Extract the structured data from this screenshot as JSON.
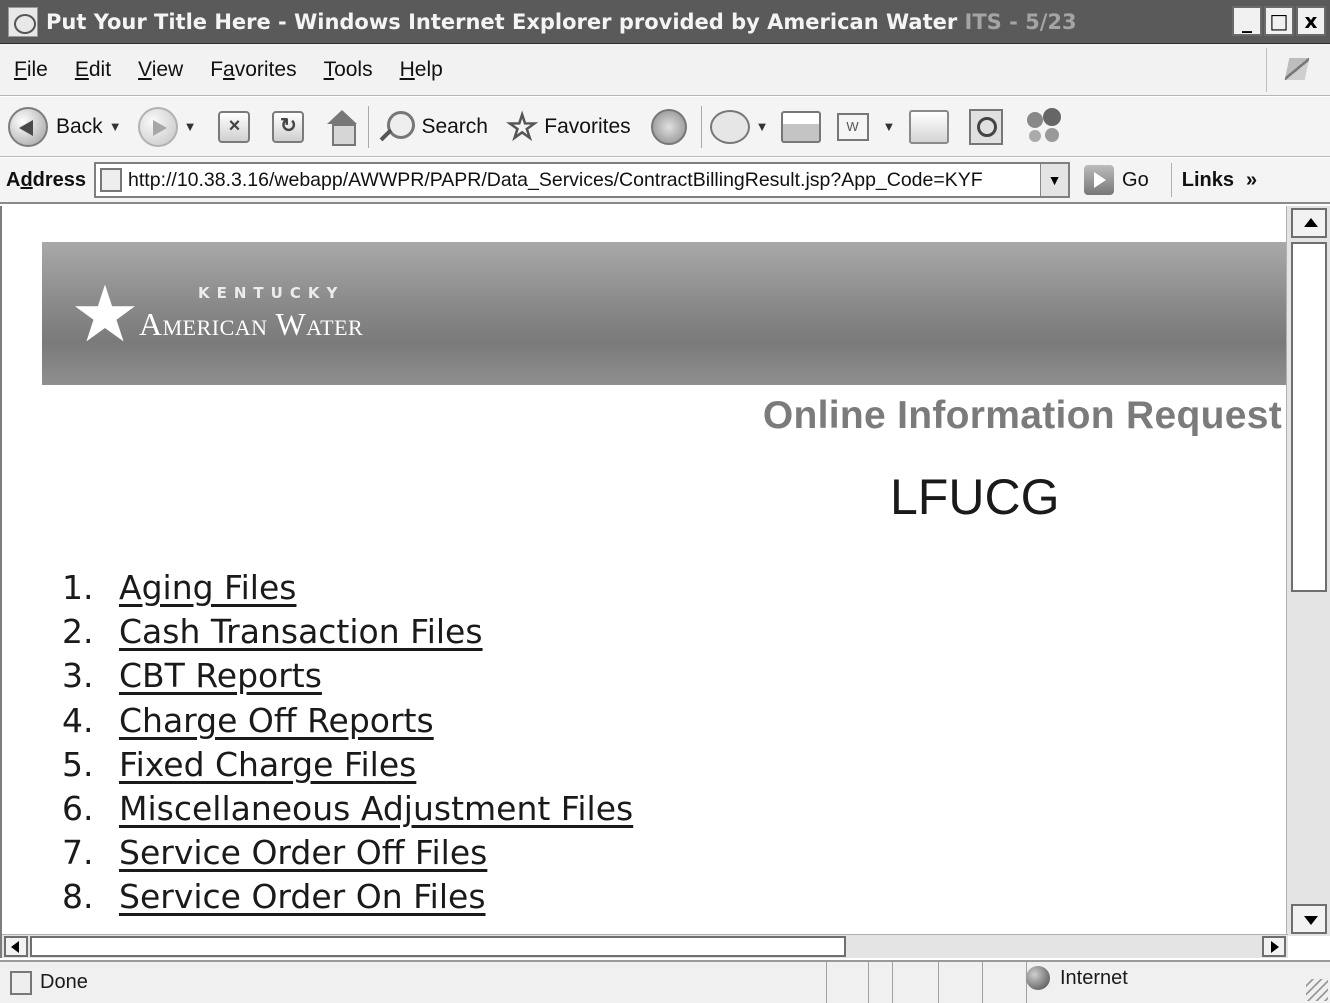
{
  "window": {
    "title": "Put Your Title Here - Windows Internet Explorer provided by American Water",
    "title_faded": " ITS - 5/23",
    "controls": {
      "minimize": "_",
      "maximize": "□",
      "close": "x"
    }
  },
  "menu": [
    {
      "ul": "F",
      "rest": "ile"
    },
    {
      "ul": "E",
      "rest": "dit"
    },
    {
      "ul": "V",
      "rest": "iew"
    },
    {
      "pre": "F",
      "ul": "a",
      "rest": "vorites"
    },
    {
      "ul": "T",
      "rest": "ools"
    },
    {
      "ul": "H",
      "rest": "elp"
    }
  ],
  "toolbar": {
    "back_label": "Back",
    "search_label": "Search",
    "favorites_label": "Favorites",
    "icons": [
      "back-icon",
      "forward-icon",
      "stop-icon",
      "refresh-icon",
      "home-icon",
      "search-icon",
      "favorites-star-icon",
      "history-icon",
      "mail-icon",
      "print-icon",
      "edit-icon",
      "discuss-icon",
      "research-icon",
      "messenger-icon"
    ]
  },
  "address": {
    "label_ul": "d",
    "label_pre": "A",
    "label_rest": "dress",
    "url": "http://10.38.3.16/webapp/AWWPR/PAPR/Data_Services/ContractBillingResult.jsp?App_Code=KYF",
    "go_label": "Go",
    "links_label": "Links",
    "links_chevron": "»"
  },
  "page": {
    "banner": {
      "state": "KENTUCKY",
      "company": "American Water"
    },
    "heading": "Online Information Request",
    "subheading": "LFUCG",
    "files": [
      {
        "num": "1.",
        "label": "Aging Files"
      },
      {
        "num": "2.",
        "label": "Cash Transaction Files"
      },
      {
        "num": "3.",
        "label": "CBT Reports"
      },
      {
        "num": "4.",
        "label": "Charge Off Reports"
      },
      {
        "num": "5.",
        "label": "Fixed Charge Files"
      },
      {
        "num": "6.",
        "label": "Miscellaneous Adjustment Files"
      },
      {
        "num": "7.",
        "label": "Service Order Off Files"
      },
      {
        "num": "8.",
        "label": "Service Order On Files"
      }
    ]
  },
  "status": {
    "text": "Done",
    "zone": "Internet"
  }
}
